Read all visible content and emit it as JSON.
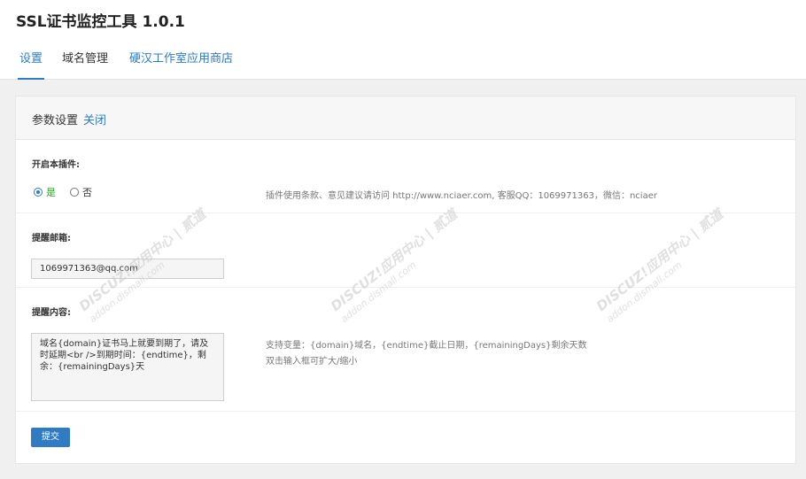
{
  "app": {
    "title": "SSL证书监控工具 1.0.1"
  },
  "tabs": [
    {
      "label": "设置",
      "active": true
    },
    {
      "label": "域名管理",
      "active": false
    },
    {
      "label": "硬汉工作室应用商店",
      "active": false
    }
  ],
  "panel": {
    "title": "参数设置",
    "close_label": "关闭",
    "enable": {
      "label": "开启本插件:",
      "options": [
        {
          "label": "是",
          "checked": true
        },
        {
          "label": "否",
          "checked": false
        }
      ],
      "hint": "插件使用条款、意见建议请访问 http://www.nciaer.com, 客服QQ：1069971363，微信：nciaer"
    },
    "email": {
      "label": "提醒邮箱:",
      "value": "1069971363@qq.com"
    },
    "content": {
      "label": "提醒内容:",
      "value": "域名{domain}证书马上就要到期了，请及时延期<br />到期时间：{endtime}，剩余：{remainingDays}天",
      "hint_line1": "支持变量：{domain}域名，{endtime}截止日期，{remainingDays}剩余天数",
      "hint_line2": "双击输入框可扩大/缩小"
    },
    "submit_label": "提交"
  },
  "watermark": {
    "brand": "DISCUZ!应用中心 | 贰道",
    "site": "addon.dismall.com"
  },
  "colors": {
    "accent": "#2f7bc4",
    "yes_option": "#22a322",
    "page_background": "#f0f0f0",
    "watermark": "#c8c8c8"
  }
}
